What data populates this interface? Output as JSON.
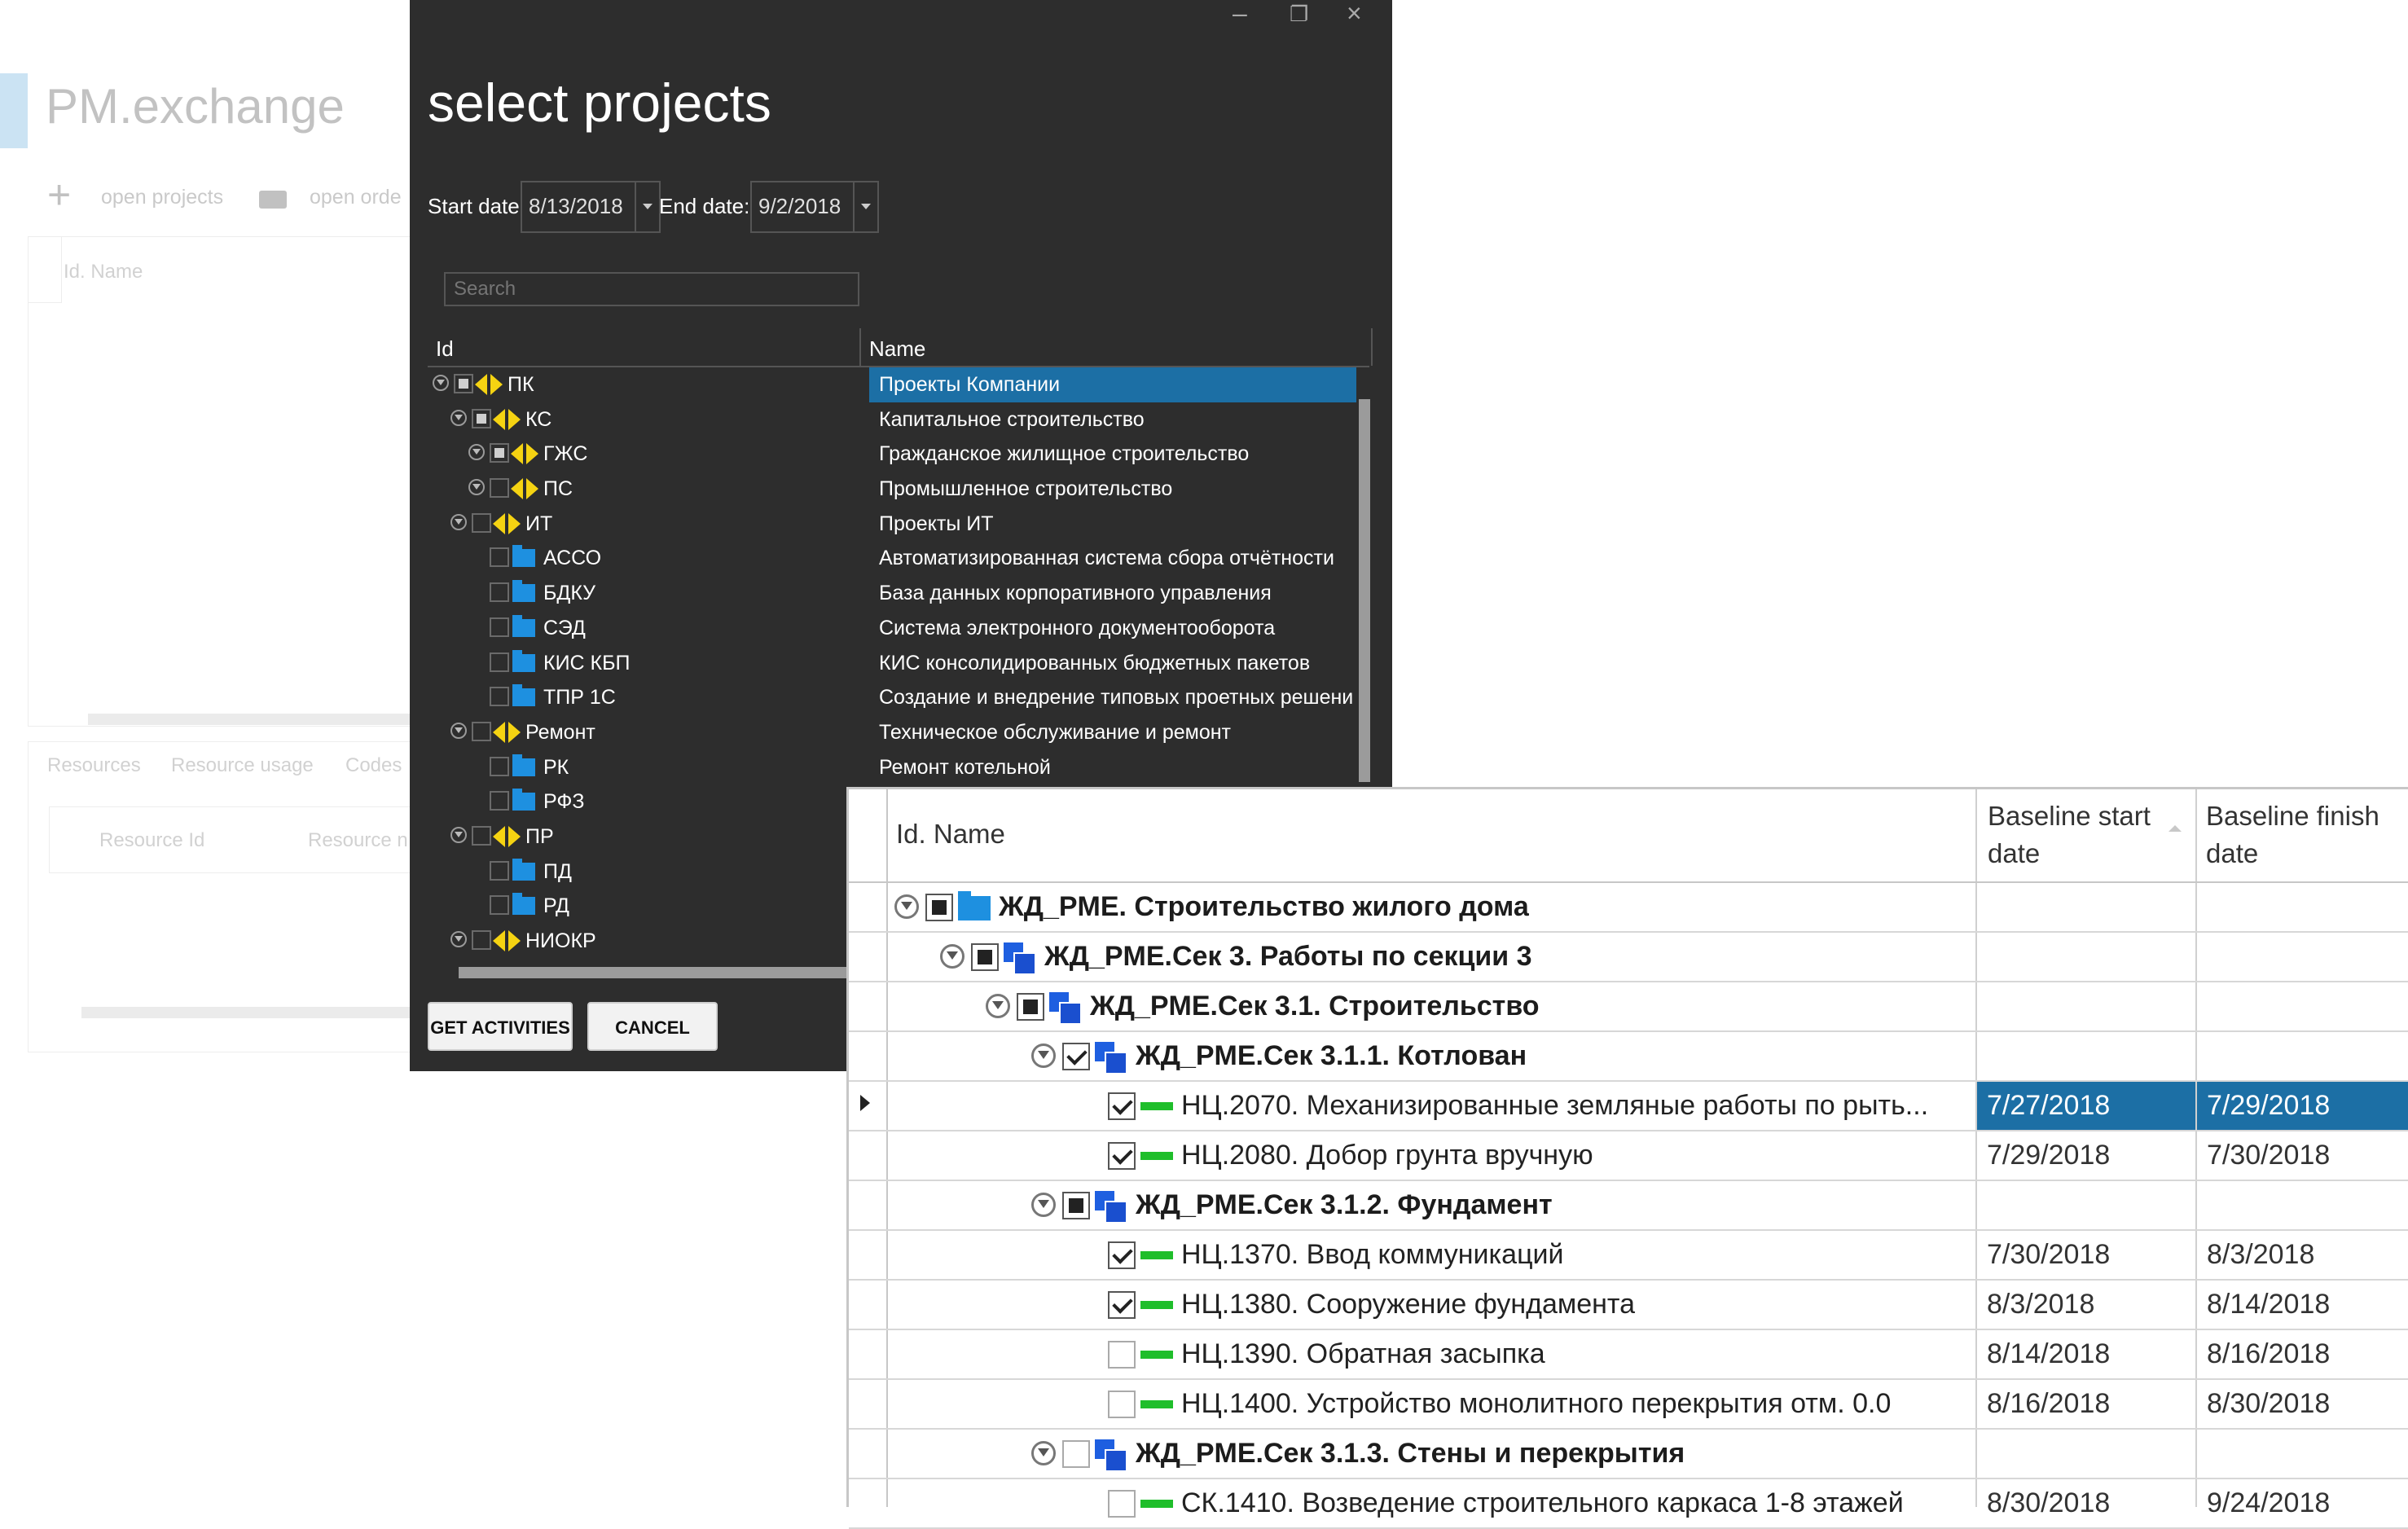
{
  "background_window": {
    "title": "PM.exchange",
    "toolbar": {
      "open_projects": "open projects",
      "open_orders": "open orde"
    },
    "grid_header": "Id. Name",
    "tabs": [
      "Resources",
      "Resource usage",
      "Codes"
    ],
    "resource_columns": [
      "Resource Id",
      "Resource n"
    ]
  },
  "dialog": {
    "title": "select projects",
    "start_label": "Start date:",
    "start_value": "8/13/2018",
    "end_label": "End date:",
    "end_value": "9/2/2018",
    "search_placeholder": "Search",
    "columns": {
      "id": "Id",
      "name": "Name"
    },
    "rows": [
      {
        "id": "ПК",
        "name": "Проекты Компании"
      },
      {
        "id": "КС",
        "name": "Капитальное строительство"
      },
      {
        "id": "ГЖС",
        "name": "Гражданское жилищное строительство"
      },
      {
        "id": "ПС",
        "name": "Промышленное строительство"
      },
      {
        "id": "ИТ",
        "name": "Проекты ИТ"
      },
      {
        "id": "АССО",
        "name": "Автоматизированная система сбора отчётности"
      },
      {
        "id": "БДКУ",
        "name": "База данных корпоративного управления"
      },
      {
        "id": "СЭД",
        "name": "Система электронного документооборота"
      },
      {
        "id": "КИС КБП",
        "name": "КИС консолидированных бюджетных пакетов"
      },
      {
        "id": "ТПР 1С",
        "name": "Создание и внедрение типовых проетных решени"
      },
      {
        "id": "Ремонт",
        "name": "Техническое обслуживание и ремонт"
      },
      {
        "id": "РК",
        "name": "Ремонт котельной"
      },
      {
        "id": "РФЗ",
        "name": ""
      },
      {
        "id": "ПР",
        "name": ""
      },
      {
        "id": "ПД",
        "name": ""
      },
      {
        "id": "РД",
        "name": ""
      },
      {
        "id": "НИОКР",
        "name": ""
      }
    ],
    "buttons": {
      "get": "GET ACTIVITIES",
      "cancel": "CANCEL"
    }
  },
  "activity_grid": {
    "columns": {
      "name": "Id. Name",
      "start": "Baseline start date",
      "finish": "Baseline finish date"
    },
    "rows": [
      {
        "name": "ЖД_PME. Строительство жилого дома",
        "start": "",
        "finish": ""
      },
      {
        "name": "ЖД_PME.Сек 3. Работы по секции 3",
        "start": "",
        "finish": ""
      },
      {
        "name": "ЖД_PME.Сек 3.1. Строительство",
        "start": "",
        "finish": ""
      },
      {
        "name": "ЖД_PME.Сек 3.1.1. Котлован",
        "start": "",
        "finish": ""
      },
      {
        "name": "НЦ.2070. Механизированные земляные работы по рыть...",
        "start": "7/27/2018",
        "finish": "7/29/2018"
      },
      {
        "name": "НЦ.2080. Добор грунта вручную",
        "start": "7/29/2018",
        "finish": "7/30/2018"
      },
      {
        "name": "ЖД_PME.Сек 3.1.2. Фундамент",
        "start": "",
        "finish": ""
      },
      {
        "name": "НЦ.1370. Ввод коммуникаций",
        "start": "7/30/2018",
        "finish": "8/3/2018"
      },
      {
        "name": "НЦ.1380. Сооружение фундамента",
        "start": "8/3/2018",
        "finish": "8/14/2018"
      },
      {
        "name": "НЦ.1390. Обратная засыпка",
        "start": "8/14/2018",
        "finish": "8/16/2018"
      },
      {
        "name": "НЦ.1400. Устройство монолитного перекрытия отм. 0.0",
        "start": "8/16/2018",
        "finish": "8/30/2018"
      },
      {
        "name": "ЖД_PME.Сек 3.1.3. Стены и перекрытия",
        "start": "",
        "finish": ""
      },
      {
        "name": "СК.1410. Возведение строительного каркаса 1-8 этажей",
        "start": "8/30/2018",
        "finish": "9/24/2018"
      }
    ]
  },
  "colors": {
    "dialog_bg": "#2d2d2d",
    "selection": "#1c6fa5",
    "wbs_diamond": "#f5d312",
    "folder": "#1e90e0",
    "activity_bar": "#1fbe2b"
  }
}
